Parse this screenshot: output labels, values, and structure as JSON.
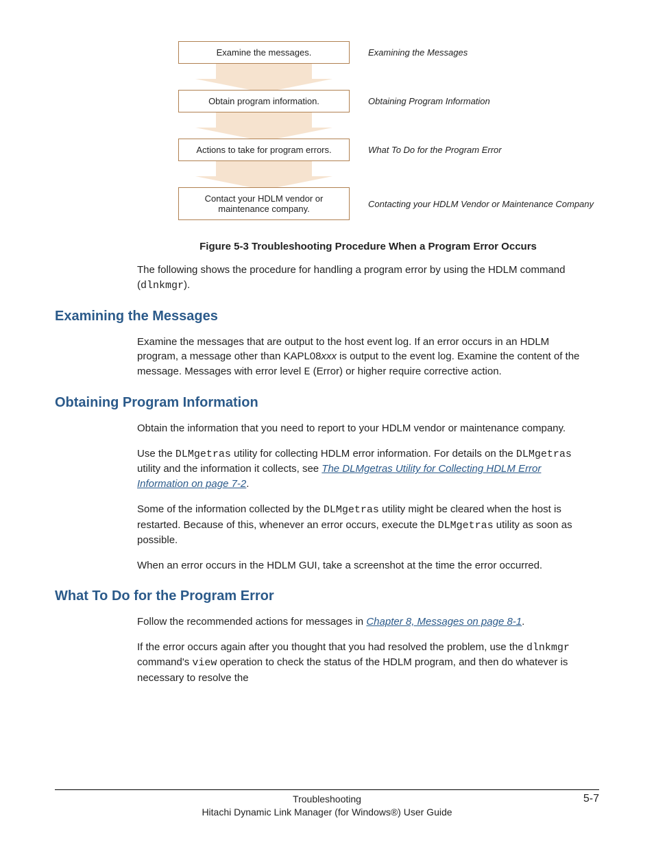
{
  "flowchart": {
    "steps": [
      {
        "box": "Examine the messages.",
        "label": "Examining the Messages"
      },
      {
        "box": "Obtain program information.",
        "label": "Obtaining Program Information"
      },
      {
        "box": "Actions to take for program errors.",
        "label": "What To Do for the Program Error"
      },
      {
        "box": "Contact your HDLM vendor or maintenance company.",
        "label": "Contacting your HDLM Vendor or Maintenance Company"
      }
    ]
  },
  "caption": "Figure 5-3 Troubleshooting Procedure When a Program Error Occurs",
  "intro_pre": "The following shows the procedure for handling a program error by using the HDLM command (",
  "intro_code": "dlnkmgr",
  "intro_post": ").",
  "sections": {
    "examining": {
      "heading": "Examining the Messages",
      "p1a": "Examine the messages that are output to the host event log. If an error occurs in an HDLM program, a message other than KAPL08",
      "p1i": "xxx",
      "p1b": " is output to the event log. Examine the content of the message. Messages with error level ",
      "p1code": "E",
      "p1c": " (Error) or higher require corrective action."
    },
    "obtaining": {
      "heading": "Obtaining Program Information",
      "p1": "Obtain the information that you need to report to your HDLM vendor or maintenance company.",
      "p2a": "Use the ",
      "p2code1": "DLMgetras",
      "p2b": " utility for collecting HDLM error information. For details on the ",
      "p2code2": "DLMgetras",
      "p2c": " utility and the information it collects, see ",
      "p2link": "The DLMgetras Utility for Collecting HDLM Error Information on page 7-2",
      "p2d": ".",
      "p3a": "Some of the information collected by the ",
      "p3code1": "DLMgetras",
      "p3b": " utility might be cleared when the host is restarted. Because of this, whenever an error occurs, execute the ",
      "p3code2": "DLMgetras",
      "p3c": " utility as soon as possible.",
      "p4": "When an error occurs in the HDLM GUI, take a screenshot at the time the error occurred."
    },
    "whattodo": {
      "heading": "What To Do for the Program Error",
      "p1a": "Follow the recommended actions for messages in ",
      "p1link": "Chapter 8, Messages on page 8-1",
      "p1b": ".",
      "p2a": "If the error occurs again after you thought that you had resolved the problem, use the ",
      "p2code1": "dlnkmgr",
      "p2b": " command's ",
      "p2code2": "view",
      "p2c": " operation to check the status of the HDLM program, and then do whatever is necessary to resolve the"
    }
  },
  "footer": {
    "section": "Troubleshooting",
    "book": "Hitachi Dynamic Link Manager (for Windows®) User Guide",
    "page": "5-7"
  }
}
